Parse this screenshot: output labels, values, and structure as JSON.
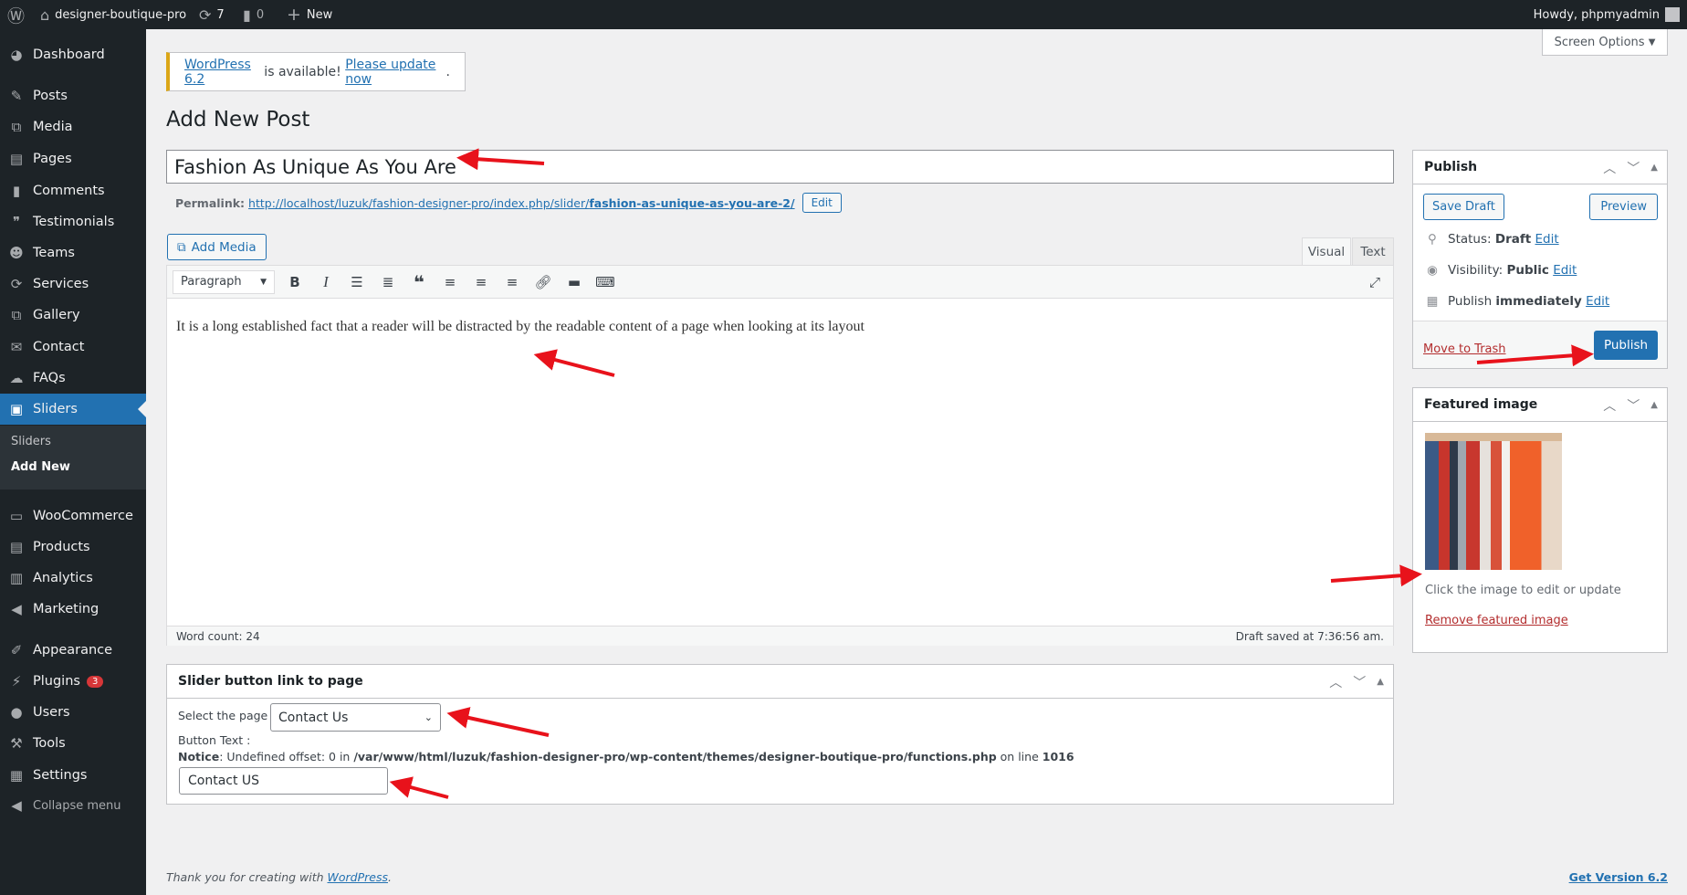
{
  "adminbar": {
    "site": "designer-boutique-pro",
    "updates": "7",
    "comments": "0",
    "new": "New",
    "howdy": "Howdy, phpmyadmin"
  },
  "sidebar": {
    "items": [
      {
        "label": "Dashboard",
        "icon": "dashboard-icon"
      },
      {
        "label": "Posts",
        "icon": "pin-icon"
      },
      {
        "label": "Media",
        "icon": "media-icon"
      },
      {
        "label": "Pages",
        "icon": "pages-icon"
      },
      {
        "label": "Comments",
        "icon": "comment-icon"
      },
      {
        "label": "Testimonials",
        "icon": "testimonial-icon"
      },
      {
        "label": "Teams",
        "icon": "groups-icon"
      },
      {
        "label": "Services",
        "icon": "services-icon"
      },
      {
        "label": "Gallery",
        "icon": "gallery-icon"
      },
      {
        "label": "Contact",
        "icon": "email-icon"
      },
      {
        "label": "FAQs",
        "icon": "faq-icon"
      },
      {
        "label": "Sliders",
        "icon": "slides-icon"
      },
      {
        "label": "WooCommerce",
        "icon": "woo-icon"
      },
      {
        "label": "Products",
        "icon": "archive-icon"
      },
      {
        "label": "Analytics",
        "icon": "chart-icon"
      },
      {
        "label": "Marketing",
        "icon": "megaphone-icon"
      },
      {
        "label": "Appearance",
        "icon": "brush-icon"
      },
      {
        "label": "Plugins",
        "icon": "plugin-icon",
        "badge": "3"
      },
      {
        "label": "Users",
        "icon": "users-icon"
      },
      {
        "label": "Tools",
        "icon": "wrench-icon"
      },
      {
        "label": "Settings",
        "icon": "settings-icon"
      },
      {
        "label": "Collapse menu",
        "icon": "collapse-icon"
      }
    ],
    "submenu": [
      "Sliders",
      "Add New"
    ]
  },
  "screen_options": "Screen Options",
  "notice": {
    "link1": "WordPress 6.2",
    "mid": " is available! ",
    "link2": "Please update now",
    "end": "."
  },
  "page_title": "Add New Post",
  "post_title": "Fashion As Unique As You Are",
  "permalink": {
    "label": "Permalink:",
    "url": "http://localhost/luzuk/fashion-designer-pro/index.php/slider/",
    "slug": "fashion-as-unique-as-you-are-2/",
    "edit": "Edit"
  },
  "add_media": "Add Media",
  "editor": {
    "tab_visual": "Visual",
    "tab_text": "Text",
    "format": "Paragraph",
    "content": "It is a long established fact that a reader will be distracted by the readable content of a page when looking at its layout",
    "word_count": "Word count: 24",
    "draft_saved": "Draft saved at 7:36:56 am."
  },
  "publish": {
    "title": "Publish",
    "save_draft": "Save Draft",
    "preview": "Preview",
    "status_label": "Status:",
    "status": "Draft",
    "visibility_label": "Visibility:",
    "visibility": "Public",
    "publish_label": "Publish",
    "publish_when": "immediately",
    "edit": "Edit",
    "trash": "Move to Trash",
    "publish_button": "Publish"
  },
  "featured": {
    "title": "Featured image",
    "hint": "Click the image to edit or update",
    "remove": "Remove featured image"
  },
  "slider_box": {
    "title": "Slider button link to page",
    "select_label": "Select the page :",
    "selected": "Contact Us",
    "button_text_label": "Button Text :",
    "notice_bold": "Notice",
    "notice_text": ": Undefined offset: 0 in ",
    "notice_path": "/var/www/html/luzuk/fashion-designer-pro/wp-content/themes/designer-boutique-pro/functions.php",
    "notice_online": " on line ",
    "notice_line": "1016",
    "button_text": "Contact US"
  },
  "footer": {
    "thanks": "Thank you for creating with ",
    "wp": "WordPress",
    "dot": ".",
    "version": "Get Version 6.2"
  },
  "colors": {
    "accent": "#2271b1",
    "sidebar": "#1d2327",
    "annotation_arrow": "#e8121b"
  }
}
